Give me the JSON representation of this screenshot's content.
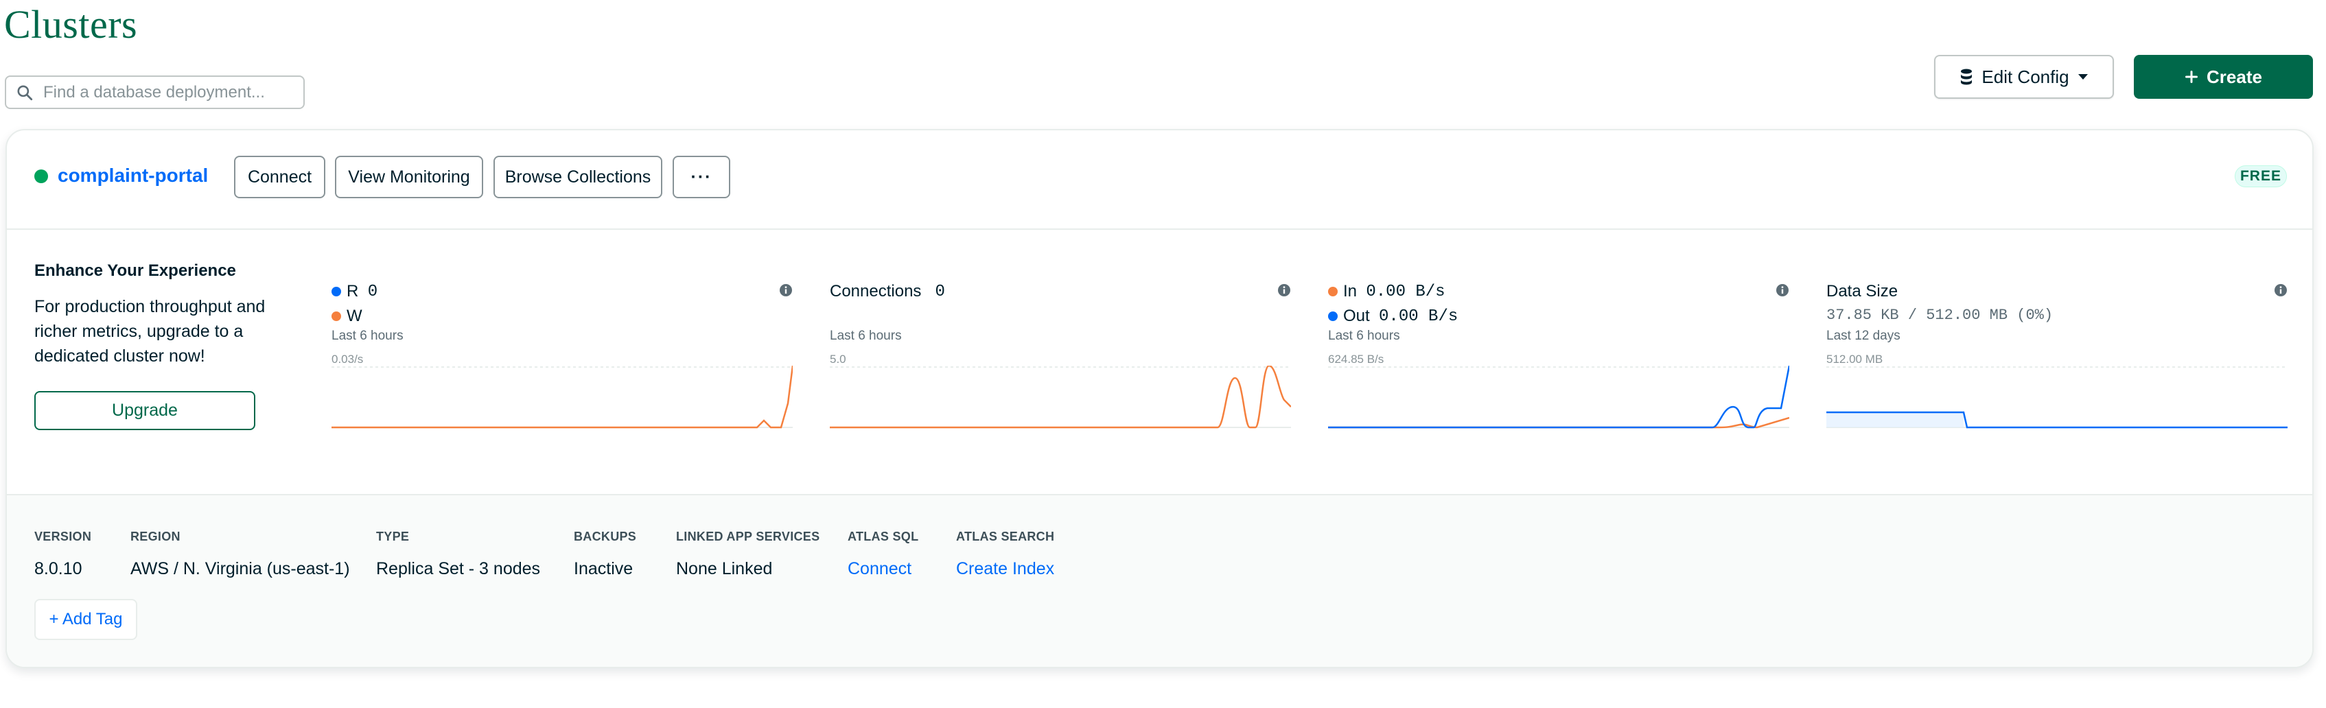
{
  "page": {
    "title": "Clusters"
  },
  "search": {
    "placeholder": "Find a database deployment..."
  },
  "toolbar": {
    "edit_config_label": "Edit Config",
    "create_label": "Create"
  },
  "cluster": {
    "name": "complaint-portal",
    "status": "active",
    "buttons": {
      "connect": "Connect",
      "view_monitoring": "View Monitoring",
      "browse_collections": "Browse Collections",
      "more": "···"
    },
    "tier_badge": "FREE"
  },
  "upsell": {
    "title": "Enhance Your Experience",
    "text": "For production throughput and richer metrics, upgrade to a dedicated cluster now!",
    "button": "Upgrade"
  },
  "metrics": {
    "opcounters": {
      "r_label": "R",
      "r_value": "0",
      "w_label": "W",
      "period": "Last 6 hours",
      "scale": "0.03/s"
    },
    "connections": {
      "label": "Connections",
      "value": "0",
      "period": "Last 6 hours",
      "scale": "5.0"
    },
    "network": {
      "in_label": "In",
      "in_value": "0.00 B/s",
      "out_label": "Out",
      "out_value": "0.00 B/s",
      "period": "Last 6 hours",
      "scale": "624.85 B/s"
    },
    "data_size": {
      "label": "Data Size",
      "value": "37.85 KB / 512.00 MB (0%)",
      "period": "Last 12 days",
      "scale": "512.00 MB"
    }
  },
  "details": {
    "version": {
      "label": "VERSION",
      "value": "8.0.10"
    },
    "region": {
      "label": "REGION",
      "value": "AWS / N. Virginia (us-east-1)"
    },
    "type": {
      "label": "TYPE",
      "value": "Replica Set - 3 nodes"
    },
    "backups": {
      "label": "BACKUPS",
      "value": "Inactive"
    },
    "linked_app_services": {
      "label": "LINKED APP SERVICES",
      "value": "None Linked"
    },
    "atlas_sql": {
      "label": "ATLAS SQL",
      "link": "Connect"
    },
    "atlas_search": {
      "label": "ATLAS SEARCH",
      "link": "Create Index"
    }
  },
  "tags": {
    "add_label": "+ Add Tag"
  },
  "colors": {
    "brand": "#00684a",
    "link": "#016bf8",
    "status_green": "#00a35c",
    "series_orange": "#f5803e",
    "series_blue": "#016bf8"
  },
  "icons": {
    "search": "search-icon",
    "database": "database-icon",
    "caret": "caret-down-icon",
    "plus": "plus-icon",
    "info": "info-icon"
  }
}
